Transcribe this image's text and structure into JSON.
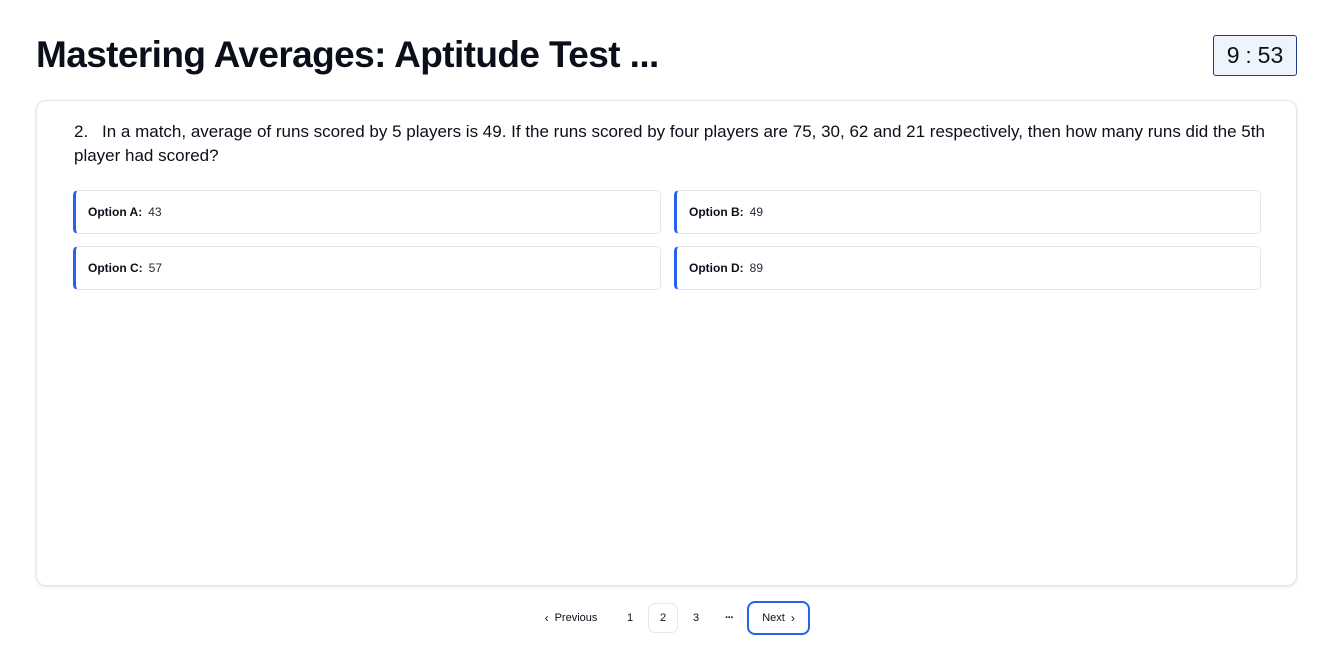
{
  "header": {
    "title": "Mastering Averages: Aptitude Test ...",
    "timer": {
      "minutes": "9",
      "separator": ":",
      "seconds": "53"
    }
  },
  "question": {
    "number": "2.",
    "text": "In a match, average of runs scored by 5 players is 49. If the runs scored by four players are 75, 30, 62 and 21 respectively, then how many runs did the 5th player had scored?"
  },
  "options": [
    {
      "label": "Option A:",
      "value": "43"
    },
    {
      "label": "Option B:",
      "value": "49"
    },
    {
      "label": "Option C:",
      "value": "57"
    },
    {
      "label": "Option D:",
      "value": "89"
    }
  ],
  "pagination": {
    "previous_label": "Previous",
    "next_label": "Next",
    "pages": [
      "1",
      "2",
      "3"
    ],
    "current_page": "2",
    "ellipsis": "···",
    "prev_icon": "chevron-left-icon",
    "next_icon": "chevron-right-icon"
  },
  "colors": {
    "accent": "#2563eb",
    "timer_border": "#1e3a8a",
    "timer_bg": "#eef4fb",
    "text": "#0b0f19"
  }
}
